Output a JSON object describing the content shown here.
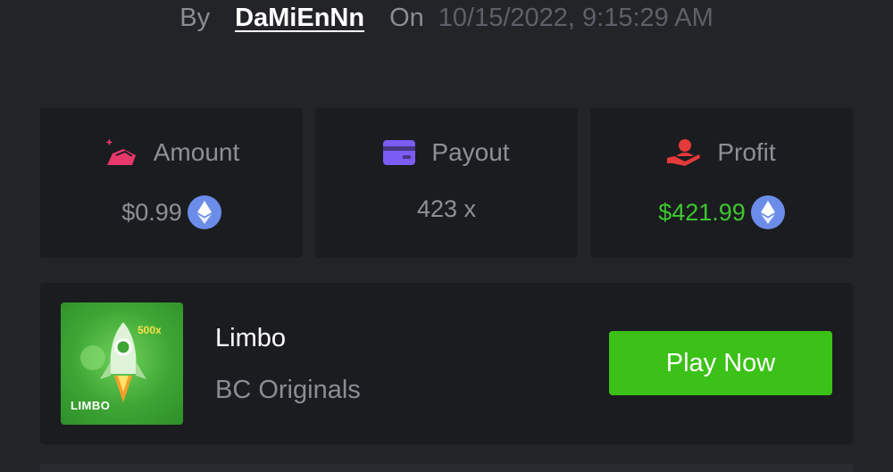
{
  "byline": {
    "by_label": "By",
    "username": "DaMiEnNn",
    "on_label": "On",
    "datetime": "10/15/2022, 9:15:29 AM"
  },
  "stats": {
    "amount": {
      "label": "Amount",
      "value": "$0.99",
      "icon": "money-bag-icon",
      "currency_icon": "ethereum-icon"
    },
    "payout": {
      "label": "Payout",
      "value": "423 x",
      "icon": "card-icon"
    },
    "profit": {
      "label": "Profit",
      "value": "$421.99",
      "icon": "hand-user-icon",
      "currency_icon": "ethereum-icon"
    }
  },
  "game": {
    "title": "Limbo",
    "subtitle": "BC Originals",
    "thumbnail_label": "LIMBO",
    "thumbnail_multiplier": "500x",
    "play_button": "Play Now"
  },
  "colors": {
    "background": "#232428",
    "card": "#1b1c20",
    "accent_green": "#3bc117",
    "profit_green": "#3dc630",
    "eth_blue": "#6b8de9",
    "amount_pink": "#e8376a",
    "payout_purple": "#7b5cf5",
    "profit_red": "#e53a3a"
  }
}
